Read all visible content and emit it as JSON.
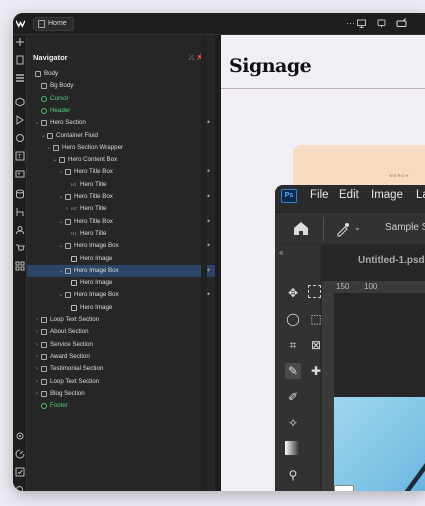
{
  "topbar": {
    "page_label": "Home"
  },
  "navigator": {
    "title": "Navigator",
    "tools": "⤩ 📌",
    "rows": [
      {
        "label": "Body",
        "depth": 0,
        "caret": "",
        "icon": "box",
        "green": false
      },
      {
        "label": "Bg Body",
        "depth": 1,
        "caret": "",
        "icon": "box",
        "green": false
      },
      {
        "label": "Cursor",
        "depth": 1,
        "caret": "",
        "icon": "gear",
        "green": true
      },
      {
        "label": "Header",
        "depth": 1,
        "caret": "",
        "icon": "gear",
        "green": true
      },
      {
        "label": "Hero Section",
        "depth": 1,
        "caret": "⌄",
        "icon": "box",
        "green": false,
        "mark": "✦"
      },
      {
        "label": "Container Fluid",
        "depth": 2,
        "caret": "⌄",
        "icon": "box",
        "green": false
      },
      {
        "label": "Hero Section Wrapper",
        "depth": 3,
        "caret": "⌄",
        "icon": "box",
        "green": false
      },
      {
        "label": "Hero Content Box",
        "depth": 4,
        "caret": "⌄",
        "icon": "box",
        "green": false
      },
      {
        "label": "Hero Title Box",
        "depth": 5,
        "caret": "⌄",
        "icon": "box",
        "green": false,
        "mark": "✦"
      },
      {
        "label": "Hero Title",
        "depth": 6,
        "caret": "",
        "icon": "h1",
        "green": false
      },
      {
        "label": "Hero Title Box",
        "depth": 5,
        "caret": "⌄",
        "icon": "box",
        "green": false,
        "mark": "✦"
      },
      {
        "label": "Hero Title",
        "depth": 6,
        "caret": "›",
        "icon": "h2",
        "green": false
      },
      {
        "label": "Hero Title Box",
        "depth": 5,
        "caret": "⌄",
        "icon": "box",
        "green": false,
        "mark": "✦"
      },
      {
        "label": "Hero Title",
        "depth": 6,
        "caret": "",
        "icon": "h1",
        "green": false
      },
      {
        "label": "Hero Image Box",
        "depth": 5,
        "caret": "⌄",
        "icon": "box",
        "green": false,
        "mark": "✦"
      },
      {
        "label": "Hero Image",
        "depth": 6,
        "caret": "",
        "icon": "img",
        "green": false
      },
      {
        "label": "Hero Image Box",
        "depth": 5,
        "caret": "⌄",
        "icon": "box",
        "green": false,
        "mark": "✦",
        "selected": true
      },
      {
        "label": "Hero Image",
        "depth": 6,
        "caret": "",
        "icon": "img",
        "green": false
      },
      {
        "label": "Hero Image Box",
        "depth": 5,
        "caret": "⌄",
        "icon": "box",
        "green": false,
        "mark": "✦"
      },
      {
        "label": "Hero Image",
        "depth": 6,
        "caret": "",
        "icon": "img",
        "green": false
      },
      {
        "label": "Loop Text Section",
        "depth": 1,
        "caret": "›",
        "icon": "box",
        "green": false
      },
      {
        "label": "About Section",
        "depth": 1,
        "caret": "›",
        "icon": "box",
        "green": false
      },
      {
        "label": "Service Section",
        "depth": 1,
        "caret": "›",
        "icon": "box",
        "green": false
      },
      {
        "label": "Award Section",
        "depth": 1,
        "caret": "›",
        "icon": "box",
        "green": false
      },
      {
        "label": "Testimonial Section",
        "depth": 1,
        "caret": "›",
        "icon": "box",
        "green": false
      },
      {
        "label": "Loop Text Section",
        "depth": 1,
        "caret": "›",
        "icon": "box",
        "green": false
      },
      {
        "label": "Blog Section",
        "depth": 1,
        "caret": "›",
        "icon": "box",
        "green": false
      },
      {
        "label": "Footer",
        "depth": 1,
        "caret": "",
        "icon": "gear",
        "green": true
      }
    ]
  },
  "canvas": {
    "brand": "Signage",
    "merch_text": "· MERCH ·"
  },
  "photoshop": {
    "logo": "Ps",
    "menus": [
      "File",
      "Edit",
      "Image",
      "Lay"
    ],
    "options_label": "Sample Siz",
    "doc_tab": "Untitled-1.psd",
    "ruler": [
      "150",
      "100"
    ]
  },
  "colors": {
    "selected_row": "#2a4566",
    "green_component": "#58cf78",
    "photoshop_blue": "#2f86d9"
  }
}
